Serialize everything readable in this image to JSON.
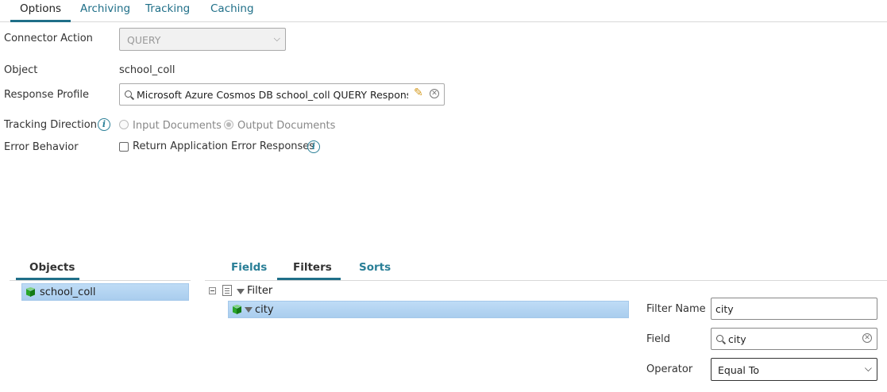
{
  "tabs": [
    {
      "label": "Options"
    },
    {
      "label": "Archiving"
    },
    {
      "label": "Tracking"
    },
    {
      "label": "Caching"
    }
  ],
  "form": {
    "connector_action": {
      "label": "Connector Action",
      "value": "QUERY"
    },
    "object": {
      "label": "Object",
      "value": "school_coll"
    },
    "response_profile": {
      "label": "Response Profile",
      "value": "Microsoft Azure Cosmos DB school_coll QUERY Response"
    },
    "tracking_direction": {
      "label": "Tracking Direction",
      "options": [
        {
          "label": "Input Documents",
          "checked": false
        },
        {
          "label": "Output Documents",
          "checked": true
        }
      ]
    },
    "error_behavior": {
      "label": "Error Behavior",
      "checkbox_label": "Return Application Error Responses",
      "checked": false
    }
  },
  "objects_panel": {
    "title": "Objects",
    "items": [
      {
        "label": "school_coll",
        "selected": true
      }
    ]
  },
  "detail_tabs": [
    {
      "label": "Fields"
    },
    {
      "label": "Filters"
    },
    {
      "label": "Sorts"
    }
  ],
  "filter_tree": {
    "root_label": "Filter",
    "children": [
      {
        "label": "city",
        "selected": true
      }
    ]
  },
  "filter_form": {
    "filter_name": {
      "label": "Filter Name",
      "value": "city"
    },
    "field": {
      "label": "Field",
      "value": "city"
    },
    "operator": {
      "label": "Operator",
      "value": "Equal To"
    }
  },
  "colors": {
    "accent": "#1f6f88",
    "selection": "#b5d5f2"
  }
}
